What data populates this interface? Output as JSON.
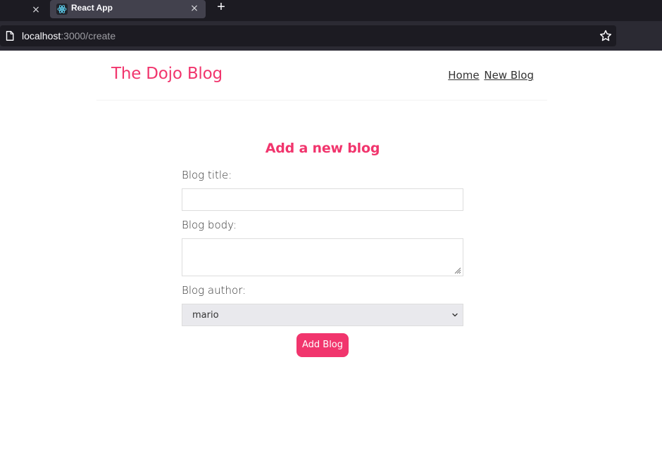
{
  "browser": {
    "tab_title": "React App",
    "prev_tab_close": "×",
    "tab_close": "×",
    "new_tab": "+",
    "url_host": "localhost",
    "url_path": ":3000/create"
  },
  "navbar": {
    "brand": "The Dojo Blog",
    "links": [
      "Home",
      "New Blog"
    ]
  },
  "form": {
    "heading": "Add a new blog",
    "title_label": "Blog title:",
    "title_value": "",
    "body_label": "Blog body:",
    "body_value": "",
    "author_label": "Blog author:",
    "author_selected": "mario",
    "submit_label": "Add Blog"
  },
  "colors": {
    "accent": "#f1356d",
    "text": "#333333",
    "chrome_dark": "#1c1b22",
    "tab_active": "#42414d"
  },
  "icons": {
    "favicon": "react-icon",
    "page": "page-icon",
    "bookmark": "star-icon",
    "select": "chevron-down-icon",
    "textarea": "resize-grip-icon"
  }
}
